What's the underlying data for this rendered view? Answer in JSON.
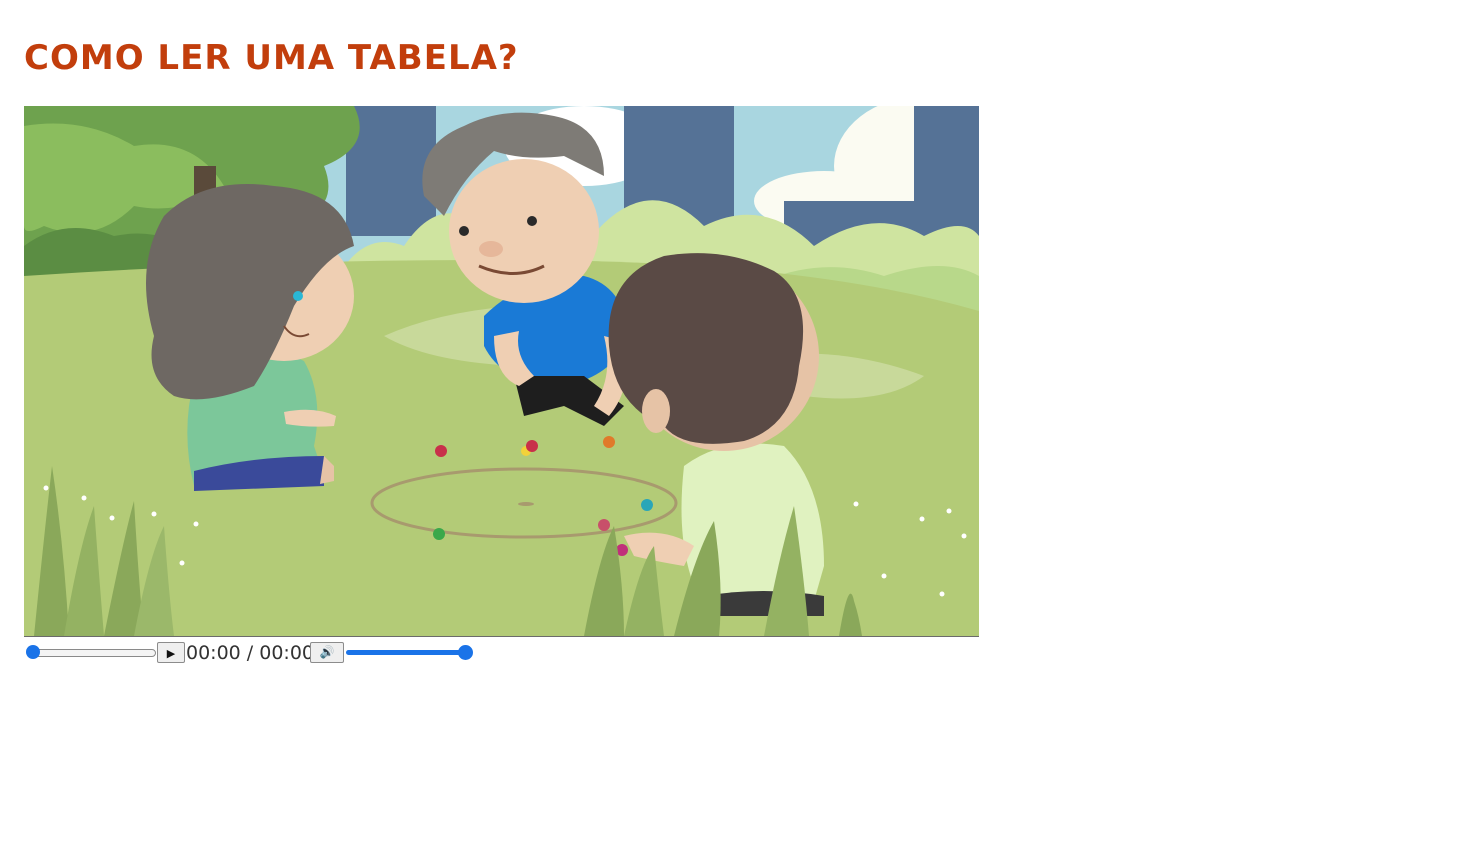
{
  "page": {
    "title": "COMO LER UMA TABELA?",
    "title_color": "#c23e0c"
  },
  "video": {
    "scene_icon": "video-thumbnail-children-playing-marbles",
    "controls": {
      "seek_progress": 0,
      "play_icon": "▶",
      "time_display": "00:00 / 00:00",
      "mute_icon": "🔊",
      "volume_level": 1,
      "accent_color": "#1a73e8"
    }
  }
}
